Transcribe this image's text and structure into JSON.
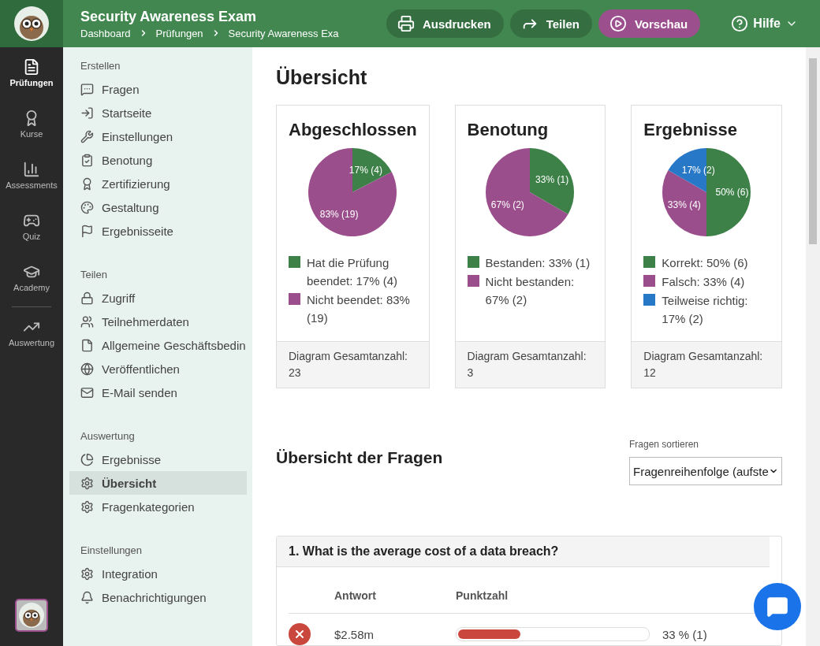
{
  "header": {
    "title": "Security Awareness Exam",
    "breadcrumb": [
      "Dashboard",
      "Prüfungen",
      "Security Awareness Exa"
    ],
    "buttons": [
      {
        "label": "Ausdrucken",
        "kind": "print"
      },
      {
        "label": "Teilen",
        "kind": "share"
      },
      {
        "label": "Vorschau",
        "kind": "preview"
      }
    ],
    "help": "Hilfe"
  },
  "rail": [
    {
      "label": "Prüfungen",
      "selected": true
    },
    {
      "label": "Kurse",
      "selected": false
    },
    {
      "label": "Assessments",
      "selected": false
    },
    {
      "label": "Quiz",
      "selected": false
    },
    {
      "label": "Academy",
      "selected": false
    },
    {
      "label": "Auswertung",
      "selected": false
    }
  ],
  "sidebar": [
    {
      "heading": "Erstellen",
      "items": [
        {
          "label": "Fragen",
          "selected": false
        },
        {
          "label": "Startseite",
          "selected": false
        },
        {
          "label": "Einstellungen",
          "selected": false
        },
        {
          "label": "Benotung",
          "selected": false
        },
        {
          "label": "Zertifizierung",
          "selected": false
        },
        {
          "label": "Gestaltung",
          "selected": false
        },
        {
          "label": "Ergebnisseite",
          "selected": false
        }
      ]
    },
    {
      "heading": "Teilen",
      "items": [
        {
          "label": "Zugriff",
          "selected": false
        },
        {
          "label": "Teilnehmerdaten",
          "selected": false
        },
        {
          "label": "Allgemeine Geschäftsbedin",
          "selected": false
        },
        {
          "label": "Veröffentlichen",
          "selected": false
        },
        {
          "label": "E-Mail senden",
          "selected": false
        }
      ]
    },
    {
      "heading": "Auswertung",
      "items": [
        {
          "label": "Ergebnisse",
          "selected": false
        },
        {
          "label": "Übersicht",
          "selected": true
        },
        {
          "label": "Fragenkategorien",
          "selected": false
        }
      ]
    },
    {
      "heading": "Einstellungen",
      "items": [
        {
          "label": "Integration",
          "selected": false
        },
        {
          "label": "Benachrichtigungen",
          "selected": false
        }
      ]
    }
  ],
  "page_title": "Übersicht",
  "cards": [
    {
      "title": "Abgeschlossen",
      "chart_data": {
        "type": "pie",
        "values": [
          4,
          19
        ],
        "value_labels": [
          "17% (4)",
          "83% (19)"
        ]
      },
      "legend": [
        {
          "text": "Hat die Prüfung beendet: 17% (4)",
          "color": "#3d8149"
        },
        {
          "text": "Nicht beendet: 83% (19)",
          "color": "#9b4e8c"
        }
      ],
      "footer": "Diagram Gesamtanzahl: 23"
    },
    {
      "title": "Benotung",
      "chart_data": {
        "type": "pie",
        "values": [
          1,
          2
        ],
        "value_labels": [
          "33% (1)",
          "67% (2)"
        ]
      },
      "legend": [
        {
          "text": "Bestanden: 33% (1)",
          "color": "#3d8149"
        },
        {
          "text": "Nicht bestanden: 67% (2)",
          "color": "#9b4e8c"
        }
      ],
      "footer": "Diagram Gesamtanzahl: 3"
    },
    {
      "title": "Ergebnisse",
      "chart_data": {
        "type": "pie",
        "values": [
          6,
          4,
          2
        ],
        "value_labels": [
          "50% (6)",
          "33% (4)",
          "17% (2)"
        ]
      },
      "legend": [
        {
          "text": "Korrekt: 50% (6)",
          "color": "#3d8149"
        },
        {
          "text": "Falsch: 33% (4)",
          "color": "#9b4e8c"
        },
        {
          "text": "Teilweise richtig: 17% (2)",
          "color": "#2878c8"
        }
      ],
      "footer": "Diagram Gesamtanzahl: 12"
    }
  ],
  "questions_section": {
    "title": "Übersicht der Fragen",
    "sort_label": "Fragen sortieren",
    "sort_value": "Fragenreihenfolge (aufste"
  },
  "question": {
    "title": "1. What is the average cost of a data breach?",
    "columns": [
      "Antwort",
      "Punktzahl"
    ],
    "answers": [
      {
        "text": "$2.58m",
        "correct": false,
        "level": 0.33,
        "reading": "33 % (1)"
      }
    ]
  }
}
